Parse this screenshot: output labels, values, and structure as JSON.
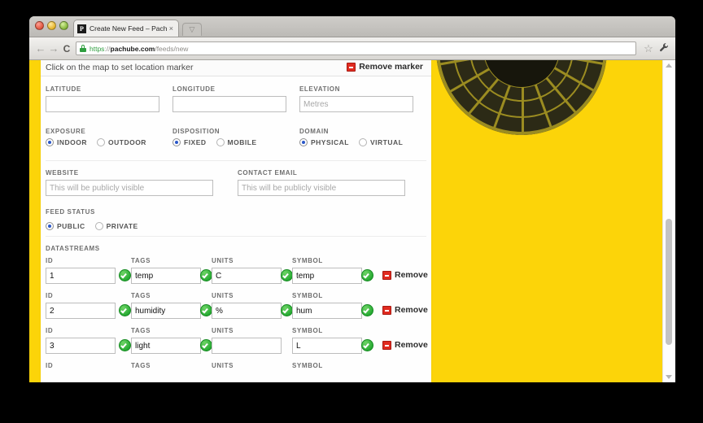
{
  "browser": {
    "tab": {
      "title": "Create New Feed – Pachube",
      "close_glyph": "×",
      "favicon_letter": "P"
    },
    "new_tab_glyph": "▽",
    "nav": {
      "back": "←",
      "forward": "→",
      "reload": "C"
    },
    "url": {
      "scheme": "https",
      "separator": "://",
      "host": "pachube.com",
      "path": "/feeds/new"
    },
    "bookmark_glyph": "☆",
    "wrench_glyph": "🔧"
  },
  "page": {
    "map_hint": "Click on the map to set location marker",
    "remove_marker": "Remove marker",
    "location": {
      "latitude": {
        "label": "LATITUDE",
        "value": "",
        "placeholder": ""
      },
      "longitude": {
        "label": "LONGITUDE",
        "value": "",
        "placeholder": ""
      },
      "elevation": {
        "label": "ELEVATION",
        "value": "",
        "placeholder": "Metres"
      }
    },
    "exposure": {
      "label": "EXPOSURE",
      "options": [
        {
          "label": "INDOOR",
          "selected": true
        },
        {
          "label": "OUTDOOR",
          "selected": false
        }
      ]
    },
    "disposition": {
      "label": "DISPOSITION",
      "options": [
        {
          "label": "FIXED",
          "selected": true
        },
        {
          "label": "MOBILE",
          "selected": false
        }
      ]
    },
    "domain": {
      "label": "DOMAIN",
      "options": [
        {
          "label": "PHYSICAL",
          "selected": true
        },
        {
          "label": "VIRTUAL",
          "selected": false
        }
      ]
    },
    "website": {
      "label": "WEBSITE",
      "value": "",
      "placeholder": "This will be publicly visible"
    },
    "contact_email": {
      "label": "CONTACT EMAIL",
      "value": "",
      "placeholder": "This will be publicly visible"
    },
    "feed_status": {
      "label": "FEED STATUS",
      "options": [
        {
          "label": "PUBLIC",
          "selected": true
        },
        {
          "label": "PRIVATE",
          "selected": false
        }
      ]
    },
    "datastreams": {
      "title": "DATASTREAMS",
      "columns": [
        "ID",
        "TAGS",
        "UNITS",
        "SYMBOL"
      ],
      "remove_label": "Remove",
      "rows": [
        {
          "id": "1",
          "tags": "temp",
          "units": "C",
          "symbol": "temp",
          "valid": {
            "id": true,
            "tags": true,
            "units": true,
            "symbol": true
          }
        },
        {
          "id": "2",
          "tags": "humidity",
          "units": "%",
          "symbol": "hum",
          "valid": {
            "id": true,
            "tags": true,
            "units": true,
            "symbol": true
          }
        },
        {
          "id": "3",
          "tags": "light",
          "units": "",
          "symbol": "L",
          "valid": {
            "id": true,
            "tags": true,
            "units": false,
            "symbol": true
          }
        }
      ],
      "partial_row_columns": [
        "ID",
        "TAGS",
        "UNITS",
        "SYMBOL"
      ]
    }
  },
  "colors": {
    "brand_yellow": "#fcd409",
    "valid_green": "#23a830",
    "remove_red": "#e02b20",
    "radio_blue": "#2a57c9"
  }
}
